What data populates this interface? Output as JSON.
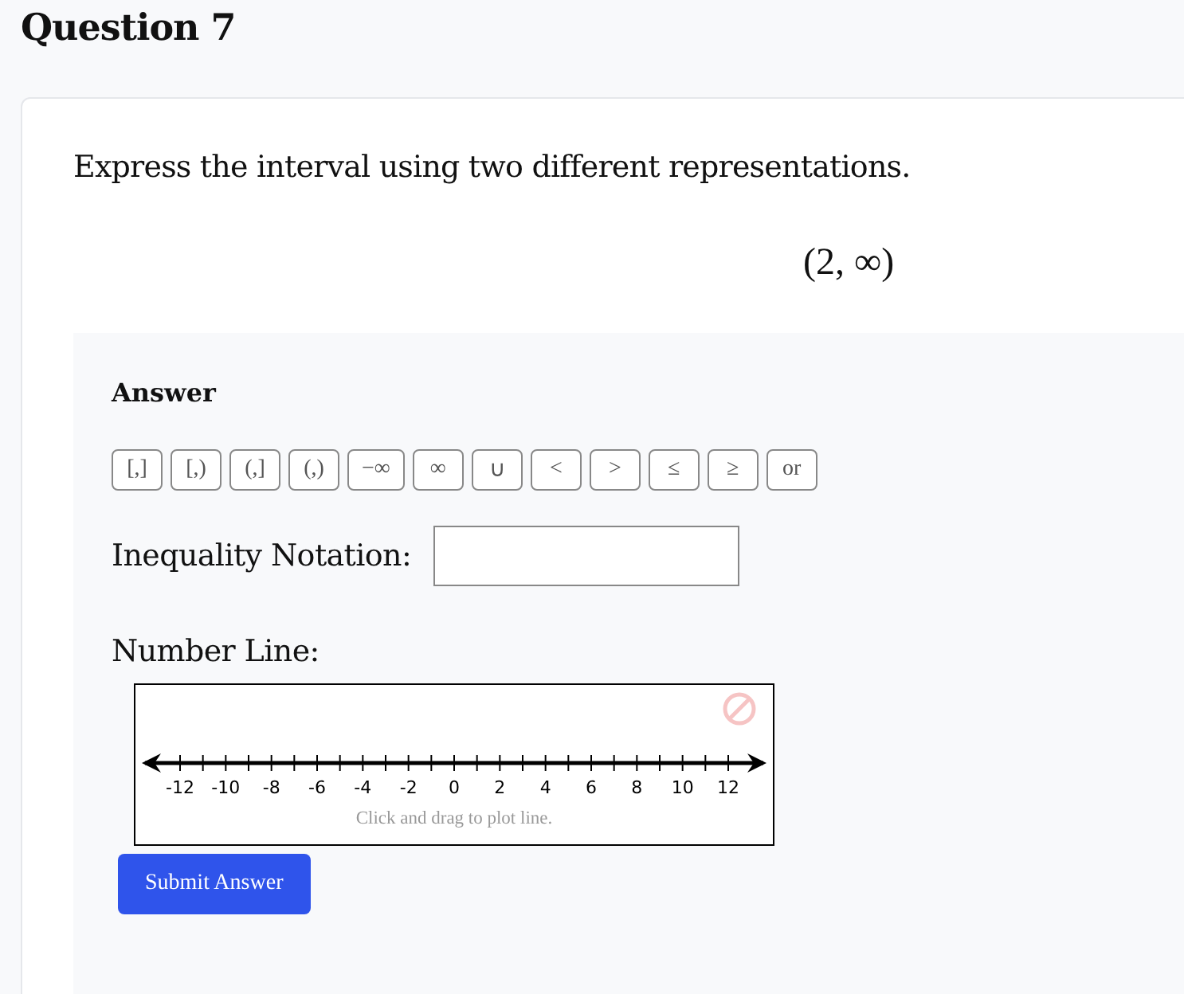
{
  "heading": "Question 7",
  "prompt": "Express the interval using two different representations.",
  "interval": "(2, ∞)",
  "answer": {
    "title": "Answer",
    "keys": [
      "[,]",
      "[,)",
      "(,]",
      "(,)",
      "−∞",
      "∞",
      "∪",
      "<",
      ">",
      "≤",
      "≥",
      "or"
    ],
    "inequality_label": "Inequality Notation:",
    "number_line_label": "Number Line:",
    "number_line": {
      "tick_labels": [
        "-12",
        "-10",
        "-8",
        "-6",
        "-4",
        "-2",
        "0",
        "2",
        "4",
        "6",
        "8",
        "10",
        "12"
      ],
      "hint": "Click and drag to plot line."
    },
    "submit": "Submit Answer"
  }
}
